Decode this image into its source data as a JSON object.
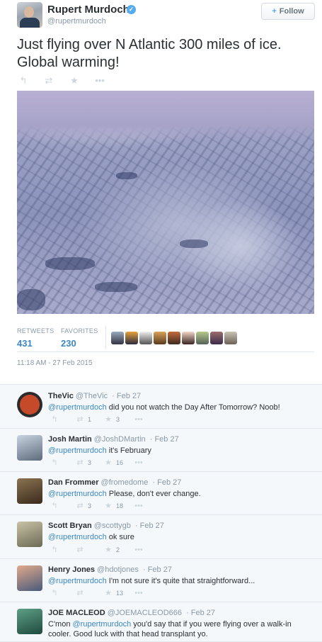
{
  "tweet": {
    "name": "Rupert Murdoch",
    "handle": "@rupertmurdoch",
    "follow_label": "Follow",
    "text": "Just flying over N Atlantic 300 miles of ice. Global warming!",
    "retweets_label": "RETWEETS",
    "retweets_count": "431",
    "favorites_label": "FAVORITES",
    "favorites_count": "230",
    "timestamp": "11:18 AM - 27 Feb 2015"
  },
  "replies": [
    {
      "name": "TheVic",
      "handle": "@TheVic",
      "date": "· Feb 27",
      "mention": "@rupertmurdoch",
      "text": " did you not watch the Day After Tomorrow? Noob!",
      "retweets": "1",
      "favorites": "3"
    },
    {
      "name": "Josh Martin",
      "handle": "@JoshDMartin",
      "date": "· Feb 27",
      "mention": "@rupertmurdoch",
      "text": " it's February",
      "retweets": "3",
      "favorites": "16"
    },
    {
      "name": "Dan Frommer",
      "handle": "@fromedome",
      "date": "· Feb 27",
      "mention": "@rupertmurdoch",
      "text": " Please, don't ever change.",
      "retweets": "3",
      "favorites": "18"
    },
    {
      "name": "Scott Bryan",
      "handle": "@scottygb",
      "date": "· Feb 27",
      "mention": "@rupertmurdoch",
      "text": " ok sure",
      "retweets": "",
      "favorites": "2"
    },
    {
      "name": "Henry Jones",
      "handle": "@hdotjones",
      "date": "· Feb 27",
      "mention": "@rupertmurdoch",
      "text": " I'm not sure it's quite that straightforward...",
      "retweets": "",
      "favorites": "13"
    },
    {
      "name": "JOE MACLEOD",
      "handle": "@JOEMACLEOD666",
      "date": "· Feb 27",
      "prefix": "C'mon ",
      "mention": "@rupertmurdoch",
      "text": " you'd say that if you were flying over a walk-in cooler. Good luck with that head transplant yo.",
      "retweets": "",
      "favorites": ""
    }
  ],
  "icons": {
    "reply": "↰",
    "retweet": "⇄",
    "favorite": "★",
    "more": "•••",
    "follow": "+👤",
    "verified": "✓"
  },
  "colors": {
    "link": "#3b88c3",
    "verified": "#55acee",
    "muted": "#8899a6"
  }
}
